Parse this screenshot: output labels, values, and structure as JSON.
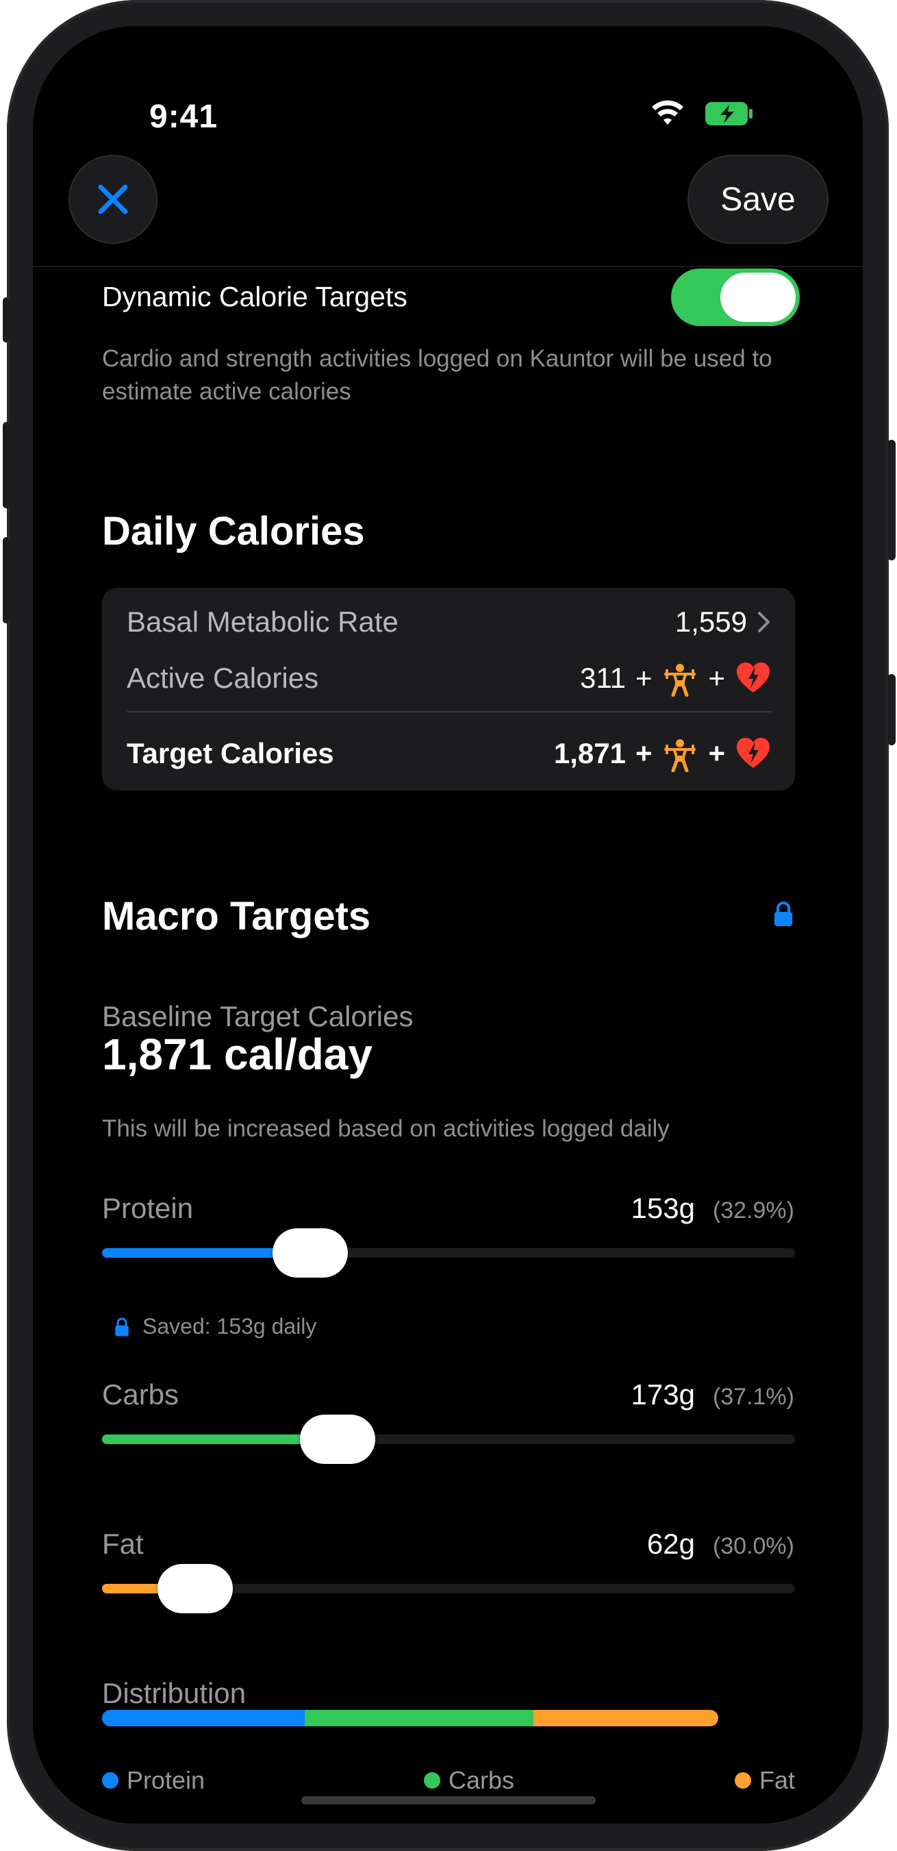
{
  "status_bar": {
    "time": "9:41"
  },
  "colors": {
    "protein": "#0a84ff",
    "carbs": "#34c759",
    "fat": "#ff9f2d",
    "accent": "#0a84ff",
    "toggle_on": "#34c759",
    "heart": "#ff3b30"
  },
  "header": {
    "save_label": "Save"
  },
  "dynamic": {
    "title": "Dynamic Calorie Targets",
    "enabled": true,
    "description": "Cardio and strength activities logged on Kauntor will be used to estimate active calories"
  },
  "daily": {
    "title": "Daily Calories",
    "bmr_label": "Basal Metabolic Rate",
    "bmr_value": "1,559",
    "active_label": "Active Calories",
    "active_value": "311",
    "target_label": "Target Calories",
    "target_value": "1,871",
    "plus": "+"
  },
  "macros": {
    "title": "Macro Targets",
    "baseline_label": "Baseline Target Calories",
    "baseline_value": "1,871 cal/day",
    "note": "This will be increased based on activities logged daily",
    "protein": {
      "name": "Protein",
      "grams": "153g",
      "pct": "(32.9%)",
      "level": 0.3
    },
    "saved_note": "Saved: 153g daily",
    "carbs": {
      "name": "Carbs",
      "grams": "173g",
      "pct": "(37.1%)",
      "level": 0.34
    },
    "fat": {
      "name": "Fat",
      "grams": "62g",
      "pct": "(30.0%)",
      "level": 0.134
    }
  },
  "distribution": {
    "title": "Distribution",
    "protein_share": 32.9,
    "carbs_share": 37.1,
    "fat_share": 30.0,
    "legend_protein": "Protein",
    "legend_carbs": "Carbs",
    "legend_fat": "Fat"
  }
}
